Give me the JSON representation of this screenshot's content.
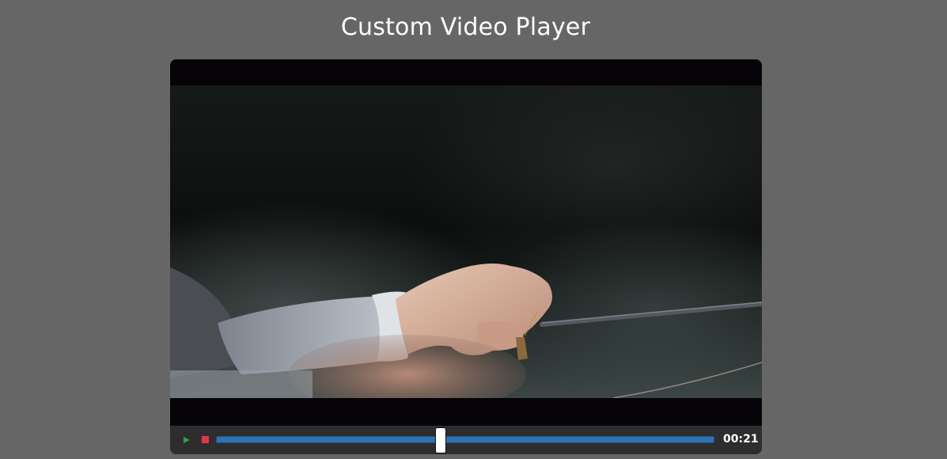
{
  "page": {
    "title": "Custom Video Player"
  },
  "player": {
    "current_time": "00:21",
    "progress_fraction": 0.45,
    "play_icon": "play-icon",
    "stop_icon": "stop-icon",
    "colors": {
      "play": "#2ea43f",
      "stop": "#e53443",
      "progress": "#2e72b2",
      "controls_bg": "#2d2d2d",
      "page_bg": "#666666"
    }
  }
}
